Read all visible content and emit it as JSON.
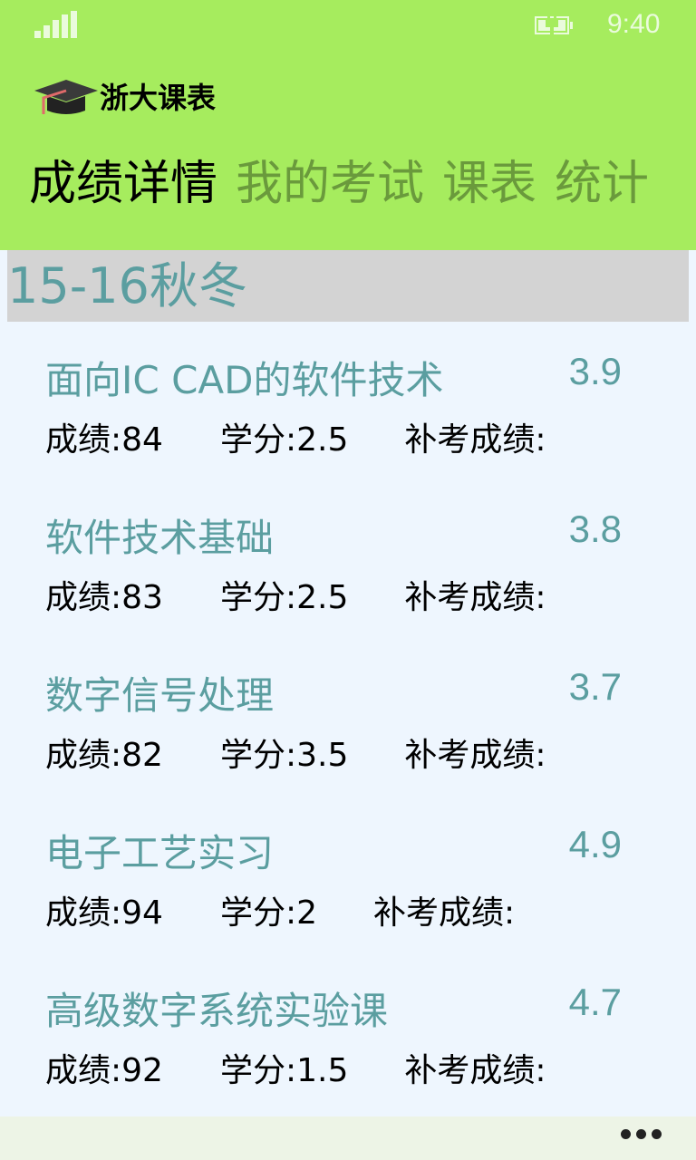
{
  "status_bar": {
    "time": "9:40"
  },
  "app": {
    "title": "浙大课表"
  },
  "pivots": [
    "成绩详情",
    "我的考试",
    "课表",
    "统计"
  ],
  "section": {
    "title": "15-16秋冬"
  },
  "labels": {
    "score": "成绩:",
    "credit": "学分:",
    "makeup": "补考成绩:"
  },
  "courses": [
    {
      "name": "面向IC CAD的软件技术",
      "gpa": "3.9",
      "score": "84",
      "credit": "2.5",
      "makeup": ""
    },
    {
      "name": "软件技术基础",
      "gpa": "3.8",
      "score": "83",
      "credit": "2.5",
      "makeup": ""
    },
    {
      "name": "数字信号处理",
      "gpa": "3.7",
      "score": "82",
      "credit": "3.5",
      "makeup": ""
    },
    {
      "name": "电子工艺实习",
      "gpa": "4.9",
      "score": "94",
      "credit": "2",
      "makeup": ""
    },
    {
      "name": "高级数字系统实验课",
      "gpa": "4.7",
      "score": "92",
      "credit": "1.5",
      "makeup": ""
    }
  ],
  "colors": {
    "header": "#a6ec5e",
    "accent": "#5b9ea0",
    "background": "#eef6fe"
  }
}
